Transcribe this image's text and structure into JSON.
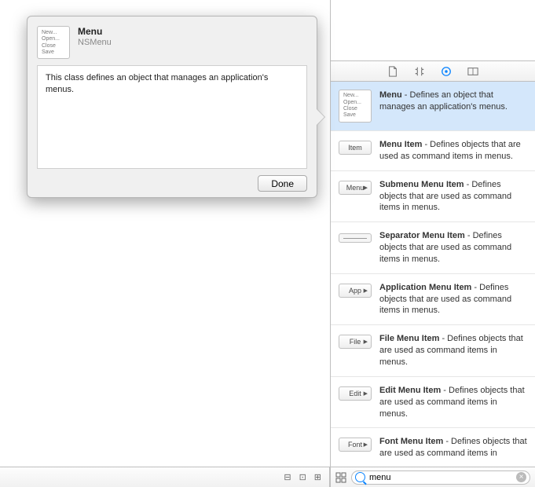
{
  "popover": {
    "title": "Menu",
    "subtitle": "NSMenu",
    "body": "This class defines an object that manages an application's menus.",
    "done_label": "Done",
    "icon_lines": [
      "New...",
      "Open...",
      "Close",
      "Save"
    ]
  },
  "library": {
    "items": [
      {
        "title": "Menu",
        "desc": " - Defines an object that manages an application's menus.",
        "icon_type": "menu",
        "icon_label": "",
        "selected": true
      },
      {
        "title": "Menu Item",
        "desc": " - Defines objects that are used as command items in menus.",
        "icon_type": "btn",
        "icon_label": "Item"
      },
      {
        "title": "Submenu Menu Item",
        "desc": " - Defines objects that are used as command items in menus.",
        "icon_type": "btnarrow",
        "icon_label": "Menu"
      },
      {
        "title": "Separator Menu Item",
        "desc": " - Defines objects that are used as command items in menus.",
        "icon_type": "sep",
        "icon_label": ""
      },
      {
        "title": "Application Menu Item",
        "desc": " - Defines objects that are used as command items in menus.",
        "icon_type": "btnarrow",
        "icon_label": "App"
      },
      {
        "title": "File Menu Item",
        "desc": " - Defines objects that are used as command items in menus.",
        "icon_type": "btnarrow",
        "icon_label": "File"
      },
      {
        "title": "Edit Menu Item",
        "desc": " - Defines objects that are used as command items in menus.",
        "icon_type": "btnarrow",
        "icon_label": "Edit"
      },
      {
        "title": "Font Menu Item",
        "desc": " - Defines objects that are used as command items in",
        "icon_type": "btnarrow",
        "icon_label": "Font"
      }
    ]
  },
  "search": {
    "value": "menu"
  },
  "bottom_icons": [
    "⊟",
    "⊡",
    "⊞"
  ]
}
